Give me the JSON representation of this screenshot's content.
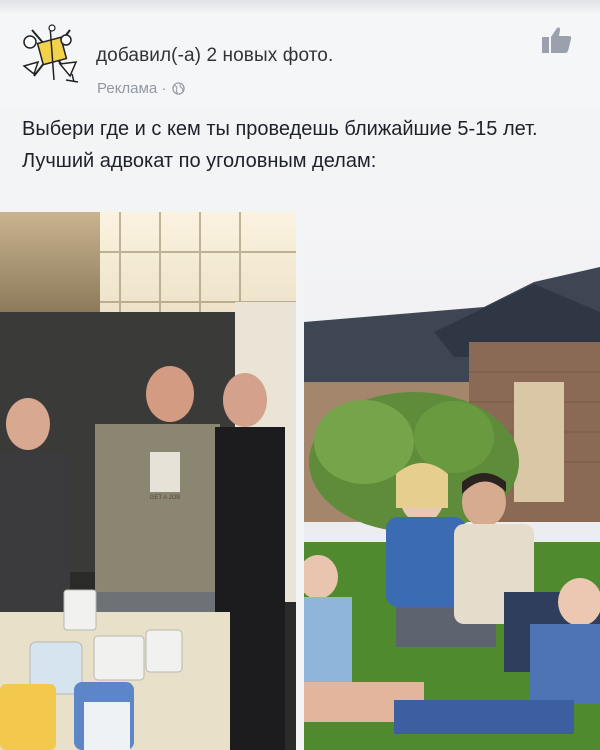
{
  "post": {
    "header_text": "добавил(-а) 2 новых фото.",
    "sponsored_label": "Реклама ·",
    "text": "Выбери где и с кем ты проведешь ближайшие 5-15 лет. Лучший адвокат по уголовным делам:"
  },
  "photos": [
    {
      "shirt_print": "GET A JOB"
    }
  ],
  "icons": {
    "avatar": "lawyer-scales-logo-icon",
    "globe": "globe-icon",
    "like": "thumbs-up-icon"
  },
  "colors": {
    "meta_gray": "#9197a3",
    "icon_gray": "#9aa1ad"
  }
}
